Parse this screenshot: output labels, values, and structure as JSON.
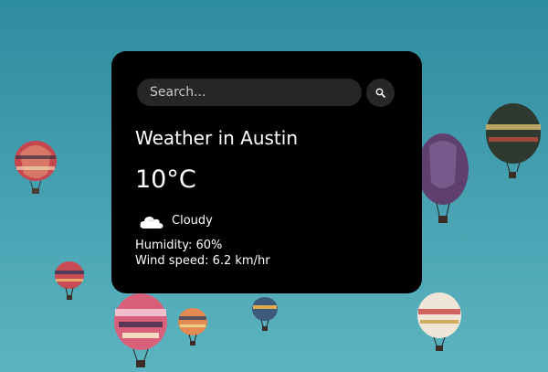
{
  "background": {
    "sky_color_top": "#2f8fa3",
    "sky_color_bottom": "#5eb6c1"
  },
  "search": {
    "placeholder": "Search...",
    "value": "",
    "button_icon": "search-icon"
  },
  "weather": {
    "title": "Weather in Austin",
    "temperature": "10°C",
    "condition_icon": "cloud-icon",
    "condition": "Cloudy",
    "humidity": "Humidity: 60%",
    "wind": "Wind speed: 6.2 km/hr"
  },
  "colors": {
    "card_bg": "#000000",
    "input_bg": "#262626",
    "text": "#ffffff"
  }
}
